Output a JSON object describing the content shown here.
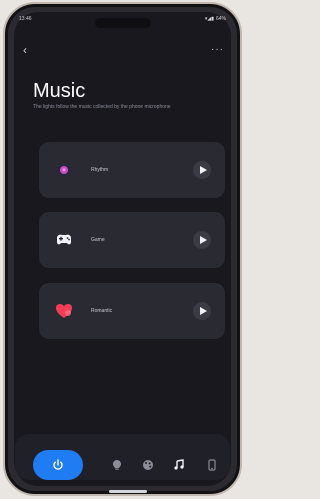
{
  "status": {
    "time": "13:46",
    "battery": "64%",
    "signal_icons": "▾◢▮"
  },
  "nav": {
    "back_icon": "‹",
    "more_icon": "···"
  },
  "page": {
    "title": "Music",
    "subtitle": "The lights follow the music collected by the phone microphone"
  },
  "modes": [
    {
      "label": "Rhythm"
    },
    {
      "label": "Game"
    },
    {
      "label": "Romantic"
    }
  ],
  "bottom_nav": {
    "power_icon": "power",
    "items": [
      "light-bulb-icon",
      "palette-icon",
      "music-icon",
      "phone-icon"
    ]
  }
}
